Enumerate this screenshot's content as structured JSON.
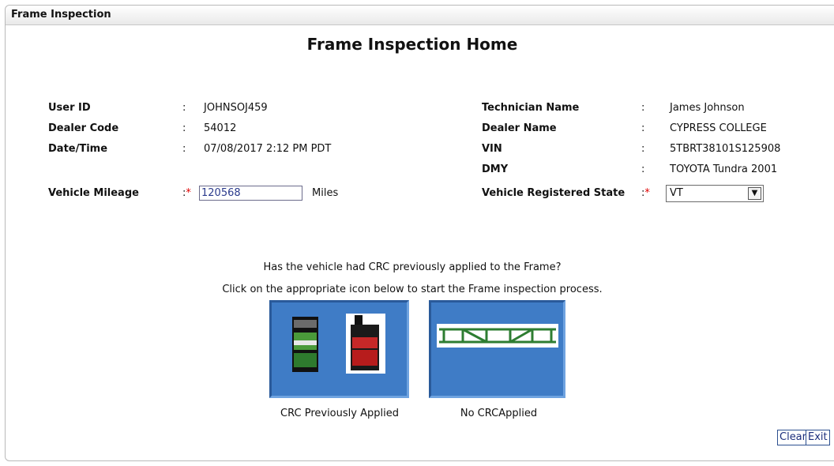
{
  "header": {
    "title": "Frame Inspection"
  },
  "page_title": "Frame Inspection Home",
  "left_fields": [
    {
      "label": "User ID",
      "colon": ":",
      "value": "JOHNSOJ459"
    },
    {
      "label": "Dealer Code",
      "colon": ":",
      "value": "54012"
    },
    {
      "label": "Date/Time",
      "colon": ":",
      "value": "07/08/2017 2:12 PM PDT"
    }
  ],
  "right_fields": [
    {
      "label": "Technician Name",
      "colon": ":",
      "value": "James Johnson"
    },
    {
      "label": "Dealer Name",
      "colon": ":",
      "value": "CYPRESS COLLEGE"
    },
    {
      "label": "VIN",
      "colon": ":",
      "value": "5TBRT38101S125908"
    },
    {
      "label": "DMY",
      "colon": ":",
      "value": "TOYOTA Tundra 2001"
    }
  ],
  "mileage": {
    "label": "Vehicle Mileage",
    "colon": ":",
    "required": "*",
    "value": "120568",
    "unit": "Miles"
  },
  "state": {
    "label": "Vehicle Registered State",
    "colon": ":",
    "required": "*",
    "selected": "VT"
  },
  "prompt": {
    "question": "Has the vehicle had CRC previously applied to the Frame?",
    "instruction": "Click on the appropriate icon below to start the Frame inspection process."
  },
  "options": [
    {
      "caption": "CRC Previously Applied",
      "icon": "crc-products-icon",
      "color": "#3f7cc6"
    },
    {
      "caption": "No CRCApplied",
      "icon": "vehicle-frame-icon",
      "color": "#3f7cc6"
    }
  ],
  "buttons": {
    "clear": "Clear",
    "exit": "Exit"
  }
}
